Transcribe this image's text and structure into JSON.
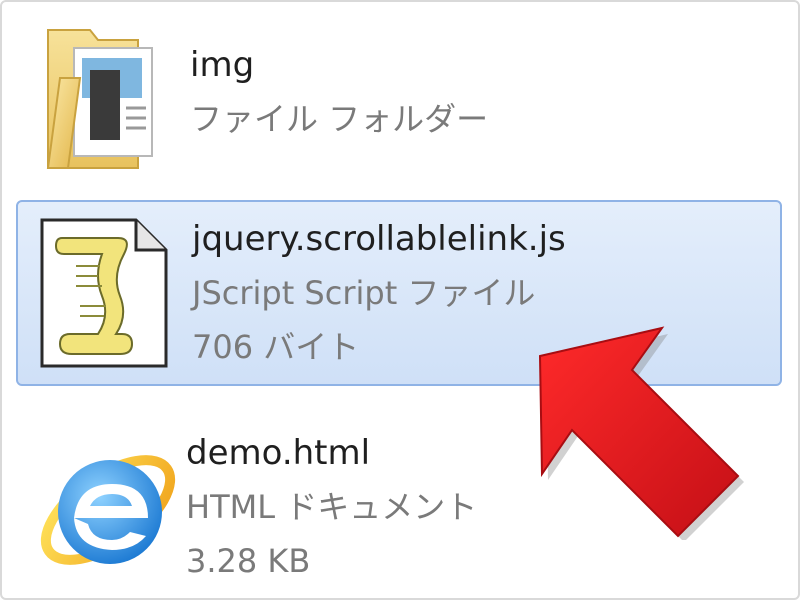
{
  "files": [
    {
      "name": "img",
      "type": "ファイル フォルダー",
      "icon": "folder-icon"
    },
    {
      "name": "jquery.scrollablelink.js",
      "type": "JScript Script ファイル",
      "size": "706 バイト",
      "icon": "script-file-icon",
      "selected": true
    },
    {
      "name": "demo.html",
      "type": "HTML ドキュメント",
      "size": "3.28 KB",
      "icon": "internet-explorer-icon"
    }
  ],
  "colors": {
    "selection_fill": "#d6e5f8",
    "selection_border": "#8fb3e6",
    "arrow": "#e8141c",
    "secondary_text": "#7a7a7a"
  }
}
